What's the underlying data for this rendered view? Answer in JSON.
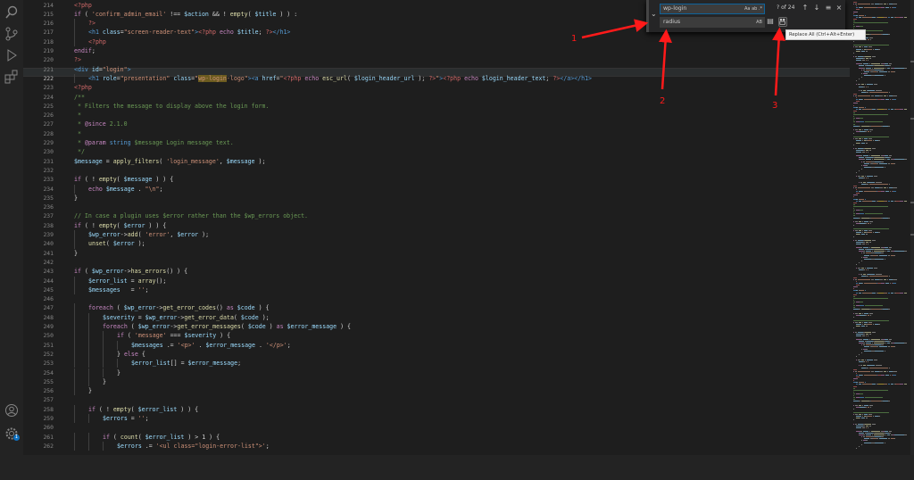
{
  "editor": {
    "current_line": "222",
    "lines": [
      {
        "n": "214",
        "indent": 0,
        "segs": [
          [
            "c-php",
            "<?php"
          ]
        ]
      },
      {
        "n": "215",
        "indent": 0,
        "segs": [
          [
            "c-kw",
            "if"
          ],
          [
            "c-op",
            " ( "
          ],
          [
            "c-str",
            "'confirm_admin_email'"
          ],
          [
            "c-op",
            " !== "
          ],
          [
            "c-var",
            "$action"
          ],
          [
            "c-op",
            " && ! "
          ],
          [
            "c-fn",
            "empty"
          ],
          [
            "c-op",
            "( "
          ],
          [
            "c-var",
            "$title"
          ],
          [
            "c-op",
            " ) ) :"
          ]
        ]
      },
      {
        "n": "216",
        "indent": 1,
        "segs": [
          [
            "c-php",
            "?>"
          ]
        ]
      },
      {
        "n": "217",
        "indent": 1,
        "segs": [
          [
            "c-tag",
            "<h1"
          ],
          [
            "c-var",
            " class"
          ],
          [
            "c-op",
            "="
          ],
          [
            "c-str",
            "\"screen-reader-text\""
          ],
          [
            "c-tag",
            ">"
          ],
          [
            "c-php",
            "<?php"
          ],
          [
            "c-kw",
            " echo "
          ],
          [
            "c-var",
            "$title"
          ],
          [
            "c-op",
            "; "
          ],
          [
            "c-php",
            "?>"
          ],
          [
            "c-tag",
            "</h1>"
          ]
        ]
      },
      {
        "n": "218",
        "indent": 1,
        "segs": [
          [
            "c-php",
            "<?php"
          ]
        ]
      },
      {
        "n": "219",
        "indent": 0,
        "segs": [
          [
            "c-kw",
            "endif"
          ],
          [
            "c-op",
            ";"
          ]
        ]
      },
      {
        "n": "220",
        "indent": 0,
        "segs": [
          [
            "c-php",
            "?>"
          ]
        ]
      },
      {
        "n": "221",
        "indent": 0,
        "segs": [
          [
            "c-tag",
            "<div"
          ],
          [
            "c-var",
            " id"
          ],
          [
            "c-op",
            "="
          ],
          [
            "c-str",
            "\"login\""
          ],
          [
            "c-tag",
            ">"
          ]
        ]
      },
      {
        "n": "222",
        "indent": 1,
        "segs": [
          [
            "c-tag",
            "<h1"
          ],
          [
            "c-var",
            " role"
          ],
          [
            "c-op",
            "="
          ],
          [
            "c-str",
            "\"presentation\""
          ],
          [
            "c-var",
            " class"
          ],
          [
            "c-op",
            "="
          ],
          [
            "c-str",
            "\""
          ],
          [
            "c-match",
            "wp-login"
          ],
          [
            "c-str",
            "-logo\""
          ],
          [
            "c-tag",
            "><a"
          ],
          [
            "c-var",
            " href"
          ],
          [
            "c-op",
            "="
          ],
          [
            "c-str",
            "\""
          ],
          [
            "c-php",
            "<?php"
          ],
          [
            "c-kw",
            " echo "
          ],
          [
            "c-fn",
            "esc_url"
          ],
          [
            "c-op",
            "( "
          ],
          [
            "c-var",
            "$login_header_url"
          ],
          [
            "c-op",
            " ); "
          ],
          [
            "c-php",
            "?>"
          ],
          [
            "c-str",
            "\""
          ],
          [
            "c-tag",
            ">"
          ],
          [
            "c-php",
            "<?php"
          ],
          [
            "c-kw",
            " echo "
          ],
          [
            "c-var",
            "$login_header_text"
          ],
          [
            "c-op",
            "; "
          ],
          [
            "c-php",
            "?>"
          ],
          [
            "c-tag",
            "</a></h1>"
          ]
        ]
      },
      {
        "n": "223",
        "indent": 0,
        "segs": [
          [
            "c-php",
            "<?php"
          ]
        ]
      },
      {
        "n": "224",
        "indent": 0,
        "segs": [
          [
            "c-com",
            "/**"
          ]
        ]
      },
      {
        "n": "225",
        "indent": 0,
        "segs": [
          [
            "c-com",
            " * Filters the message to display above the login form."
          ]
        ]
      },
      {
        "n": "226",
        "indent": 0,
        "segs": [
          [
            "c-com",
            " *"
          ]
        ]
      },
      {
        "n": "227",
        "indent": 0,
        "segs": [
          [
            "c-com",
            " * "
          ],
          [
            "c-kw",
            "@since"
          ],
          [
            "c-com",
            " 2.1.0"
          ]
        ]
      },
      {
        "n": "228",
        "indent": 0,
        "segs": [
          [
            "c-com",
            " *"
          ]
        ]
      },
      {
        "n": "229",
        "indent": 0,
        "segs": [
          [
            "c-com",
            " * "
          ],
          [
            "c-kw",
            "@param"
          ],
          [
            "c-tag",
            " string"
          ],
          [
            "c-com",
            " $message Login message text."
          ]
        ]
      },
      {
        "n": "230",
        "indent": 0,
        "segs": [
          [
            "c-com",
            " */"
          ]
        ]
      },
      {
        "n": "231",
        "indent": 0,
        "segs": [
          [
            "c-var",
            "$message"
          ],
          [
            "c-op",
            " = "
          ],
          [
            "c-fn",
            "apply_filters"
          ],
          [
            "c-op",
            "( "
          ],
          [
            "c-str",
            "'login_message'"
          ],
          [
            "c-op",
            ", "
          ],
          [
            "c-var",
            "$message"
          ],
          [
            "c-op",
            " );"
          ]
        ]
      },
      {
        "n": "232",
        "indent": 0,
        "segs": []
      },
      {
        "n": "233",
        "indent": 0,
        "segs": [
          [
            "c-kw",
            "if"
          ],
          [
            "c-op",
            " ( ! "
          ],
          [
            "c-fn",
            "empty"
          ],
          [
            "c-op",
            "( "
          ],
          [
            "c-var",
            "$message"
          ],
          [
            "c-op",
            " ) ) {"
          ]
        ]
      },
      {
        "n": "234",
        "indent": 1,
        "segs": [
          [
            "c-kw",
            "echo "
          ],
          [
            "c-var",
            "$message"
          ],
          [
            "c-op",
            " . "
          ],
          [
            "c-str",
            "\"\\n\""
          ],
          [
            "c-op",
            ";"
          ]
        ]
      },
      {
        "n": "235",
        "indent": 0,
        "segs": [
          [
            "c-op",
            "}"
          ]
        ]
      },
      {
        "n": "236",
        "indent": 0,
        "segs": []
      },
      {
        "n": "237",
        "indent": 0,
        "segs": [
          [
            "c-com",
            "// In case a plugin uses $error rather than the $wp_errors object."
          ]
        ]
      },
      {
        "n": "238",
        "indent": 0,
        "segs": [
          [
            "c-kw",
            "if"
          ],
          [
            "c-op",
            " ( ! "
          ],
          [
            "c-fn",
            "empty"
          ],
          [
            "c-op",
            "( "
          ],
          [
            "c-var",
            "$error"
          ],
          [
            "c-op",
            " ) ) {"
          ]
        ]
      },
      {
        "n": "239",
        "indent": 1,
        "segs": [
          [
            "c-var",
            "$wp_error"
          ],
          [
            "c-op",
            "->"
          ],
          [
            "c-fn",
            "add"
          ],
          [
            "c-op",
            "( "
          ],
          [
            "c-str",
            "'error'"
          ],
          [
            "c-op",
            ", "
          ],
          [
            "c-var",
            "$error"
          ],
          [
            "c-op",
            " );"
          ]
        ]
      },
      {
        "n": "240",
        "indent": 1,
        "segs": [
          [
            "c-fn",
            "unset"
          ],
          [
            "c-op",
            "( "
          ],
          [
            "c-var",
            "$error"
          ],
          [
            "c-op",
            " );"
          ]
        ]
      },
      {
        "n": "241",
        "indent": 0,
        "segs": [
          [
            "c-op",
            "}"
          ]
        ]
      },
      {
        "n": "242",
        "indent": 0,
        "segs": []
      },
      {
        "n": "243",
        "indent": 0,
        "segs": [
          [
            "c-kw",
            "if"
          ],
          [
            "c-op",
            " ( "
          ],
          [
            "c-var",
            "$wp_error"
          ],
          [
            "c-op",
            "->"
          ],
          [
            "c-fn",
            "has_errors"
          ],
          [
            "c-op",
            "() ) {"
          ]
        ]
      },
      {
        "n": "244",
        "indent": 1,
        "segs": [
          [
            "c-var",
            "$error_list"
          ],
          [
            "c-op",
            " = "
          ],
          [
            "c-fn",
            "array"
          ],
          [
            "c-op",
            "();"
          ]
        ]
      },
      {
        "n": "245",
        "indent": 1,
        "segs": [
          [
            "c-var",
            "$messages"
          ],
          [
            "c-op",
            "   = "
          ],
          [
            "c-str",
            "''"
          ],
          [
            "c-op",
            ";"
          ]
        ]
      },
      {
        "n": "246",
        "indent": 0,
        "segs": []
      },
      {
        "n": "247",
        "indent": 1,
        "segs": [
          [
            "c-kw",
            "foreach"
          ],
          [
            "c-op",
            " ( "
          ],
          [
            "c-var",
            "$wp_error"
          ],
          [
            "c-op",
            "->"
          ],
          [
            "c-fn",
            "get_error_codes"
          ],
          [
            "c-op",
            "() "
          ],
          [
            "c-kw",
            "as"
          ],
          [
            "c-var",
            " $code"
          ],
          [
            "c-op",
            " ) {"
          ]
        ]
      },
      {
        "n": "248",
        "indent": 2,
        "segs": [
          [
            "c-var",
            "$severity"
          ],
          [
            "c-op",
            " = "
          ],
          [
            "c-var",
            "$wp_error"
          ],
          [
            "c-op",
            "->"
          ],
          [
            "c-fn",
            "get_error_data"
          ],
          [
            "c-op",
            "( "
          ],
          [
            "c-var",
            "$code"
          ],
          [
            "c-op",
            " );"
          ]
        ]
      },
      {
        "n": "249",
        "indent": 2,
        "segs": [
          [
            "c-kw",
            "foreach"
          ],
          [
            "c-op",
            " ( "
          ],
          [
            "c-var",
            "$wp_error"
          ],
          [
            "c-op",
            "->"
          ],
          [
            "c-fn",
            "get_error_messages"
          ],
          [
            "c-op",
            "( "
          ],
          [
            "c-var",
            "$code"
          ],
          [
            "c-op",
            " ) "
          ],
          [
            "c-kw",
            "as"
          ],
          [
            "c-var",
            " $error_message"
          ],
          [
            "c-op",
            " ) {"
          ]
        ]
      },
      {
        "n": "250",
        "indent": 3,
        "segs": [
          [
            "c-kw",
            "if"
          ],
          [
            "c-op",
            " ( "
          ],
          [
            "c-str",
            "'message'"
          ],
          [
            "c-op",
            " === "
          ],
          [
            "c-var",
            "$severity"
          ],
          [
            "c-op",
            " ) {"
          ]
        ]
      },
      {
        "n": "251",
        "indent": 4,
        "segs": [
          [
            "c-var",
            "$messages"
          ],
          [
            "c-op",
            " .= "
          ],
          [
            "c-str",
            "'<p>'"
          ],
          [
            "c-op",
            " . "
          ],
          [
            "c-var",
            "$error_message"
          ],
          [
            "c-op",
            " . "
          ],
          [
            "c-str",
            "'</p>'"
          ],
          [
            "c-op",
            ";"
          ]
        ]
      },
      {
        "n": "252",
        "indent": 3,
        "segs": [
          [
            "c-op",
            "} "
          ],
          [
            "c-kw",
            "else"
          ],
          [
            "c-op",
            " {"
          ]
        ]
      },
      {
        "n": "253",
        "indent": 4,
        "segs": [
          [
            "c-var",
            "$error_list"
          ],
          [
            "c-op",
            "[] = "
          ],
          [
            "c-var",
            "$error_message"
          ],
          [
            "c-op",
            ";"
          ]
        ]
      },
      {
        "n": "254",
        "indent": 3,
        "segs": [
          [
            "c-op",
            "}"
          ]
        ]
      },
      {
        "n": "255",
        "indent": 2,
        "segs": [
          [
            "c-op",
            "}"
          ]
        ]
      },
      {
        "n": "256",
        "indent": 1,
        "segs": [
          [
            "c-op",
            "}"
          ]
        ]
      },
      {
        "n": "257",
        "indent": 0,
        "segs": []
      },
      {
        "n": "258",
        "indent": 1,
        "segs": [
          [
            "c-kw",
            "if"
          ],
          [
            "c-op",
            " ( ! "
          ],
          [
            "c-fn",
            "empty"
          ],
          [
            "c-op",
            "( "
          ],
          [
            "c-var",
            "$error_list"
          ],
          [
            "c-op",
            " ) ) {"
          ]
        ]
      },
      {
        "n": "259",
        "indent": 2,
        "segs": [
          [
            "c-var",
            "$errors"
          ],
          [
            "c-op",
            " = "
          ],
          [
            "c-str",
            "''"
          ],
          [
            "c-op",
            ";"
          ]
        ]
      },
      {
        "n": "260",
        "indent": 0,
        "segs": []
      },
      {
        "n": "261",
        "indent": 2,
        "segs": [
          [
            "c-kw",
            "if"
          ],
          [
            "c-op",
            " ( "
          ],
          [
            "c-fn",
            "count"
          ],
          [
            "c-op",
            "( "
          ],
          [
            "c-var",
            "$error_list"
          ],
          [
            "c-op",
            " ) > 1 ) {"
          ]
        ]
      },
      {
        "n": "262",
        "indent": 3,
        "segs": [
          [
            "c-var",
            "$errors"
          ],
          [
            "c-op",
            " .= "
          ],
          [
            "c-str",
            "'<ul class=\"login-error-list\">'"
          ],
          [
            "c-op",
            ";"
          ]
        ]
      }
    ]
  },
  "find_widget": {
    "find_value": "wp-login",
    "replace_value": "radius",
    "match_count": "? of 24",
    "find_opts": "Aa  ab  .*",
    "replace_opts": "AB",
    "tooltip": "Replace All (Ctrl+Alt+Enter)"
  },
  "annotations": {
    "one": "1",
    "two": "2",
    "three": "3",
    "color": "#ff1a1a"
  },
  "icons": {
    "activity_bar": [
      "search-icon",
      "source-control-icon",
      "run-debug-icon",
      "extensions-icon",
      "account-icon",
      "settings-gear-icon"
    ],
    "find_buttons": [
      "previous-match-icon",
      "next-match-icon",
      "find-in-selection-icon",
      "close-icon"
    ],
    "replace_buttons": [
      "replace-icon",
      "replace-all-icon"
    ]
  },
  "settings_badge": "1"
}
